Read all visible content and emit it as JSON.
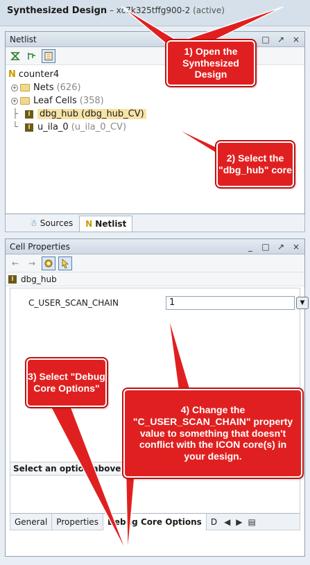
{
  "title_bar": {
    "main": "Synthesized Design",
    "sub": "– xc7k325tffg900-2",
    "status": "(active)"
  },
  "netlist": {
    "title": "Netlist",
    "win_controls": [
      "□",
      "↗",
      "×"
    ],
    "tree": {
      "root": "counter4",
      "nets_label": "Nets",
      "nets_count": "(626)",
      "leaf_label": "Leaf Cells",
      "leaf_count": "(358)",
      "dbg_hub": "dbg_hub (dbg_hub_CV)",
      "u_ila": "u_ila_0",
      "u_ila_sub": "(u_ila_0_CV)"
    }
  },
  "view_tabs": {
    "sources": "Sources",
    "netlist": "Netlist"
  },
  "cell_properties": {
    "title": "Cell Properties",
    "win_controls": [
      "_",
      "□",
      "↗",
      "×"
    ],
    "selected": "dbg_hub",
    "prop_name": "C_USER_SCAN_CHAIN",
    "prop_value": "1",
    "desc_header": "Select an option above to see a description of it",
    "bottom_tabs": [
      "General",
      "Properties",
      "Debug Core Options",
      "D"
    ]
  },
  "callouts": {
    "c1": "1) Open the Synthesized Design",
    "c2": "2) Select the \"dbg_hub\" core",
    "c3": "3) Select \"Debug Core Options\"",
    "c4": "4) Change the \"C_USER_SCAN_CHAIN\" property value to something that doesn't conflict with the ICON core(s) in your design."
  },
  "colors": {
    "callout": "#e02020",
    "selection": "#f7e3a6",
    "panel_header": "#cfd9e4"
  }
}
